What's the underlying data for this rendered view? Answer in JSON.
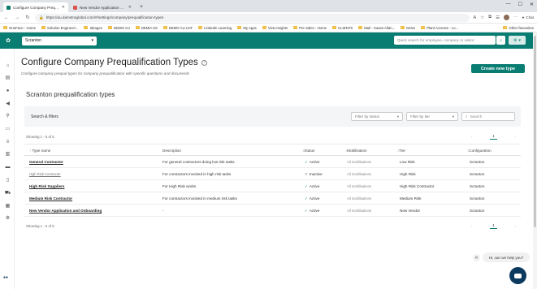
{
  "browser": {
    "tabs": [
      {
        "label": "Configure Company Prequalificat",
        "active": true
      },
      {
        "label": "New Vendor Application and Onb",
        "active": false
      }
    ],
    "url": "https://au.damstraglobal.com/#/settings/company/prequalification-types",
    "chat_label": "Chat",
    "bookmarks": [
      "OneFace - Home",
      "Solution Engineeri...",
      "Ideagen",
      "DEMO AU",
      "DEMO US",
      "DEMO AU UAT",
      "LinkedIn Learning",
      "My Apps",
      "Viva Insights",
      "Pre Sales - Home",
      "CLIENTS",
      "Mail - Susan Allan...",
      "Delve",
      "Plant Accesss - Lo..."
    ],
    "bookmarks_right": "Other favourites"
  },
  "appbar": {
    "site_value": "Scranton",
    "quick_search_placeholder": "Quick search for employee, company or visitor"
  },
  "page": {
    "title": "Configure Company Prequalification Types",
    "subtitle": "Configure company prequal types for company prequalification with specific questions and documents",
    "create_button": "Create new type",
    "section_title": "Scranton prequalification types"
  },
  "filters": {
    "label": "Search & filters",
    "status_placeholder": "Filter by status",
    "tier_placeholder": "Filter by tier",
    "search_placeholder": "Search"
  },
  "pagination": {
    "showing_top": "Showing 1 - 5 of 5",
    "showing_bottom": "Showing 1 - 5 of 5",
    "page": "1"
  },
  "table": {
    "columns": [
      "Type name",
      "Description",
      "Status",
      "Mobilisation",
      "Tier",
      "Configuration"
    ],
    "rows": [
      {
        "name": "General Contractor",
        "description": "For general contractors doing low risk tasks",
        "status": "Active",
        "mobilisation": "All mobilisations",
        "tier": "Low Risk",
        "configuration": "Scranton"
      },
      {
        "name": "High Risk Contractor",
        "description": "For contractors involved in high risk tasks",
        "status": "Inactive",
        "mobilisation": "All mobilisations",
        "tier": "High Risk",
        "configuration": "Scranton"
      },
      {
        "name": "High Risk Suppliers",
        "description": "For High Risk works",
        "status": "Active",
        "mobilisation": "All mobilisations",
        "tier": "High Risk Contractor",
        "configuration": "Scranton"
      },
      {
        "name": "Medium Risk Contractor",
        "description": "For contractors involved in medium risk tasks",
        "status": "Active",
        "mobilisation": "All mobilisations",
        "tier": "Medium Risk",
        "configuration": "Scranton"
      },
      {
        "name": "New Vendor Application and Onboarding",
        "description": "-",
        "status": "Active",
        "mobilisation": "All mobilisations",
        "tier": "New Vendor",
        "configuration": "Scranton"
      }
    ]
  },
  "chat": {
    "greeting": "Hi, can we help you?"
  },
  "colors": {
    "brand": "#0a7d73",
    "chat": "#0c3a5e"
  }
}
